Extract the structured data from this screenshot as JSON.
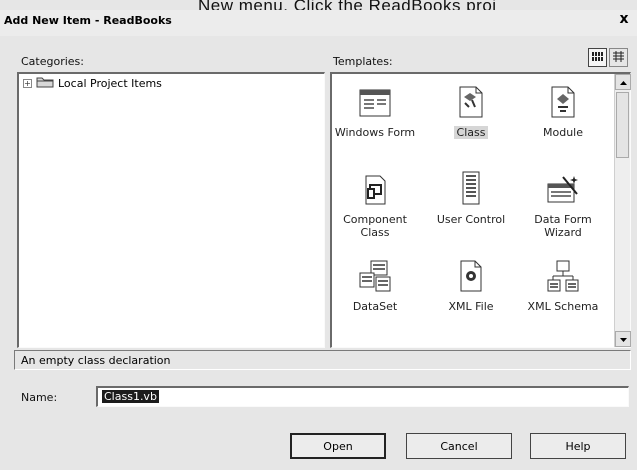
{
  "background_text": "New menu. Click the ReadBooks proj",
  "window": {
    "title": "Add New Item - ReadBooks",
    "close_glyph": "x"
  },
  "categories": {
    "label": "Categories:",
    "items": [
      {
        "label": "Local Project Items",
        "expander": "+"
      }
    ]
  },
  "templates": {
    "label": "Templates:",
    "view_buttons": [
      "large-icons-view",
      "list-view"
    ],
    "items": [
      {
        "label": "Windows Form",
        "icon": "windows-form-icon",
        "selected": false
      },
      {
        "label": "Class",
        "icon": "class-icon",
        "selected": true
      },
      {
        "label": "Module",
        "icon": "module-icon",
        "selected": false
      },
      {
        "label": "Component Class",
        "icon": "component-class-icon",
        "selected": false
      },
      {
        "label": "User Control",
        "icon": "user-control-icon",
        "selected": false
      },
      {
        "label": "Data Form Wizard",
        "icon": "data-form-wizard-icon",
        "selected": false
      },
      {
        "label": "DataSet",
        "icon": "dataset-icon",
        "selected": false
      },
      {
        "label": "XML File",
        "icon": "xml-file-icon",
        "selected": false
      },
      {
        "label": "XML Schema",
        "icon": "xml-schema-icon",
        "selected": false
      }
    ]
  },
  "description": "An empty class declaration",
  "name_field": {
    "label": "Name:",
    "value": "Class1.vb"
  },
  "buttons": {
    "open": "Open",
    "cancel": "Cancel",
    "help": "Help"
  },
  "colors": {
    "dialog_bg": "#e6e6e6",
    "panel_bg": "#ffffff",
    "selection": "#1c1c1c"
  }
}
